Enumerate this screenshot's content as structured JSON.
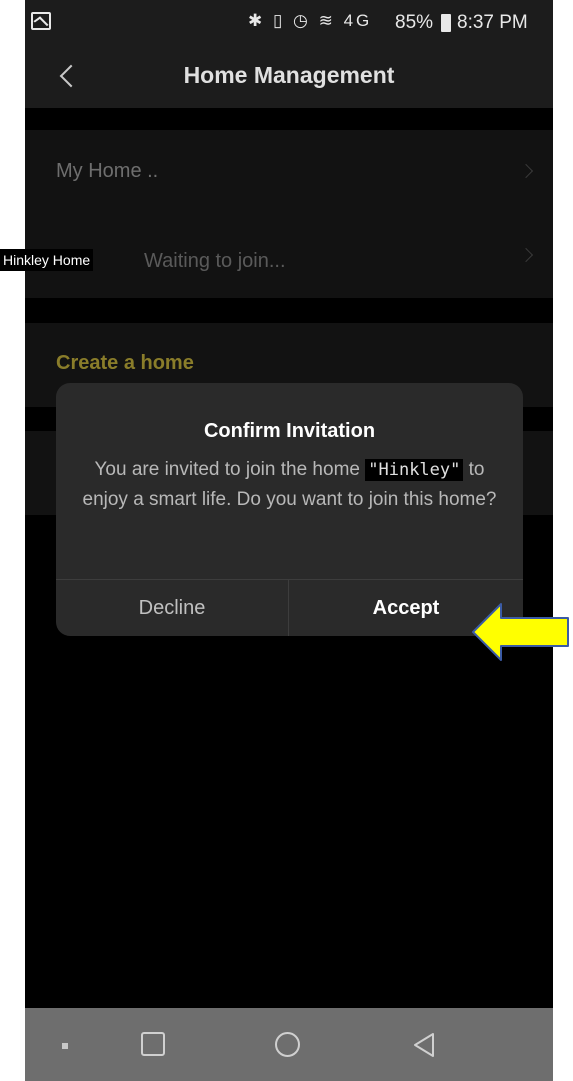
{
  "status_bar": {
    "icons_text": "✱ ▯ ◷ ≋ 4G",
    "battery": "85%",
    "time": "8:37 PM"
  },
  "header": {
    "title": "Home Management"
  },
  "homes": [
    {
      "label": "My Home .."
    },
    {
      "tag": "Hinkley Home",
      "status": "Waiting to join..."
    }
  ],
  "create_home_label": "Create a home",
  "dialog": {
    "title": "Confirm Invitation",
    "message_before": "You are invited to join the home ",
    "home_name": "\"Hinkley\"",
    "message_after": " to enjoy a smart life. Do you want to join this home?",
    "decline_label": "Decline",
    "accept_label": "Accept"
  },
  "colors": {
    "accent_create": "#8a7d2a",
    "arrow_fill": "#ffff00",
    "arrow_stroke": "#3b5ba5"
  }
}
